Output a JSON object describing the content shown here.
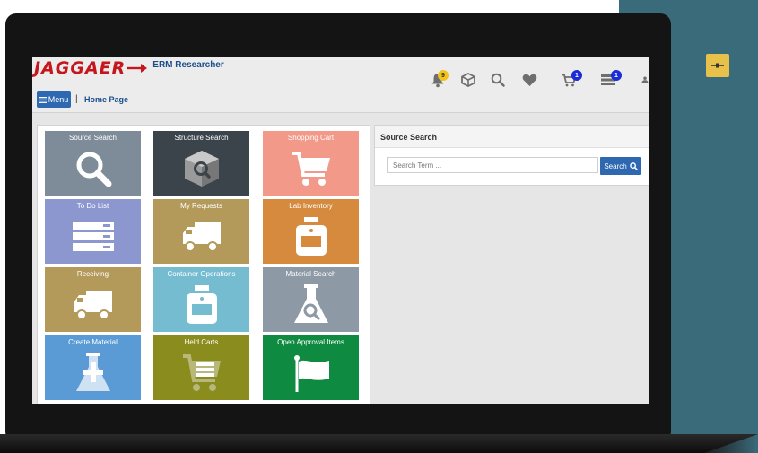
{
  "app": {
    "brand": "JAGGAER",
    "product": "ERM Researcher"
  },
  "nav": {
    "menu_label": "Menu",
    "separator": "|",
    "breadcrumb": "Home Page"
  },
  "header_icons": [
    {
      "name": "bell-icon",
      "badge": "9"
    },
    {
      "name": "box-icon",
      "badge": ""
    },
    {
      "name": "search-icon",
      "badge": ""
    },
    {
      "name": "heart-icon",
      "badge": ""
    },
    {
      "name": "cart-icon",
      "badge": "1"
    },
    {
      "name": "list-icon",
      "badge": "1"
    },
    {
      "name": "user-icon",
      "badge": ""
    }
  ],
  "tiles": [
    {
      "label": "Source Search",
      "icon": "search-icon",
      "color": "#7e8b99"
    },
    {
      "label": "Structure Search",
      "icon": "cube-search-icon",
      "color": "#3b434b"
    },
    {
      "label": "Shopping Cart",
      "icon": "shopping-cart-icon",
      "color": "#f2998a"
    },
    {
      "label": "To Do List",
      "icon": "todo-list-icon",
      "color": "#8d97cf"
    },
    {
      "label": "My Requests",
      "icon": "truck-icon",
      "color": "#b39a5b"
    },
    {
      "label": "Lab Inventory",
      "icon": "jar-icon",
      "color": "#d58a3d"
    },
    {
      "label": "Receiving",
      "icon": "truck-icon",
      "color": "#b39a5b"
    },
    {
      "label": "Container Operations",
      "icon": "jar-icon",
      "color": "#76bcd1"
    },
    {
      "label": "Material Search",
      "icon": "flask-search-icon",
      "color": "#8e99a6"
    },
    {
      "label": "Create Material",
      "icon": "flask-plus-icon",
      "color": "#5b9bd5"
    },
    {
      "label": "Held Carts",
      "icon": "held-cart-icon",
      "color": "#8b8c1e"
    },
    {
      "label": "Open Approval Items",
      "icon": "flag-icon",
      "color": "#0f8a41"
    }
  ],
  "source_search": {
    "title": "Source Search",
    "placeholder": "Search Term ...",
    "button_label": "Search"
  },
  "colors": {
    "brand_red": "#c4161c",
    "primary_blue": "#2e68b0",
    "teal_background": "#3a6b7a",
    "pin_yellow": "#e7c14a",
    "badge_yellow": "#f2c318",
    "badge_blue": "#1a2bd8"
  }
}
